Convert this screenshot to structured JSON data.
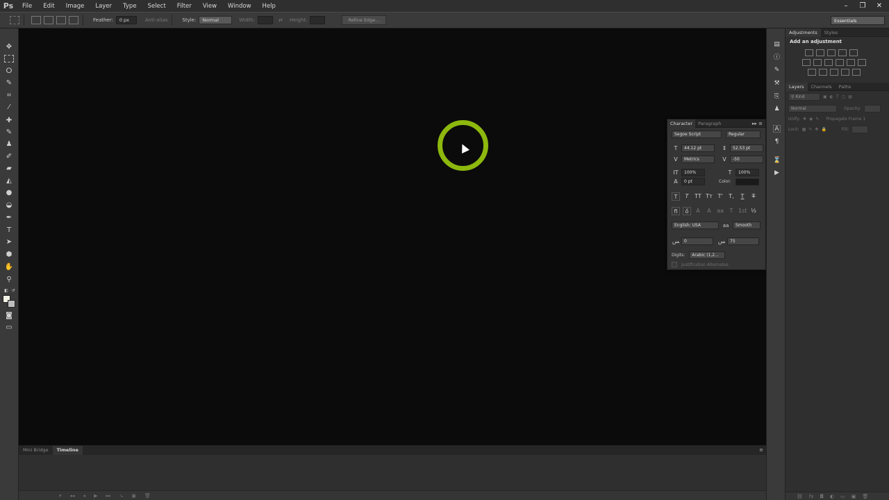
{
  "app": {
    "logo": "Ps",
    "menu": [
      "File",
      "Edit",
      "Image",
      "Layer",
      "Type",
      "Select",
      "Filter",
      "View",
      "Window",
      "Help"
    ],
    "window_controls": [
      "minimize",
      "restore",
      "close"
    ]
  },
  "options_bar": {
    "feather_label": "Feather:",
    "feather_value": "0 px",
    "antialias_label": "Anti-alias",
    "style_label": "Style:",
    "style_value": "Normal",
    "width_label": "Width:",
    "height_label": "Height:",
    "refine_edge": "Refine Edge...",
    "workspace": "Essentials"
  },
  "bottom_panel": {
    "tabs": [
      "Mini Bridge",
      "Timeline"
    ],
    "active_tab": "Timeline"
  },
  "right_panel": {
    "adjustments_tabs": [
      "Adjustments",
      "Styles"
    ],
    "adjustments_title": "Add an adjustment",
    "layers_tabs": [
      "Layers",
      "Channels",
      "Paths"
    ],
    "kind_label": "Kind",
    "blend_mode": "Normal",
    "opacity_label": "Opacity:",
    "unify_label": "Unify:",
    "propagate_label": "Propagate Frame 1",
    "lock_label": "Lock:",
    "fill_label": "Fill:"
  },
  "character_panel": {
    "tabs": [
      "Character",
      "Paragraph"
    ],
    "font_family": "Segoe Script",
    "font_style": "Regular",
    "font_size": "44.12 pt",
    "leading": "52.53 pt",
    "kerning": "Metrics",
    "tracking": "-50",
    "vertical_scale": "100%",
    "horizontal_scale": "100%",
    "baseline_shift": "0 pt",
    "color_label": "Color:",
    "language": "English: USA",
    "antialias_icon": "aa",
    "antialias": "Smooth",
    "kashida_left": "0",
    "kashida_right": "75",
    "digits_label": "Digits:",
    "digits_value": "Arabic (1,2...",
    "justification_label": "Justification Alternates",
    "style_buttons": [
      "T",
      "T",
      "TT",
      "Tт",
      "T'",
      "T,",
      "T",
      "T"
    ],
    "opentype_buttons": [
      "ﬁ",
      "ő",
      "A",
      "A",
      "aa",
      "T",
      "1st",
      "½"
    ]
  }
}
